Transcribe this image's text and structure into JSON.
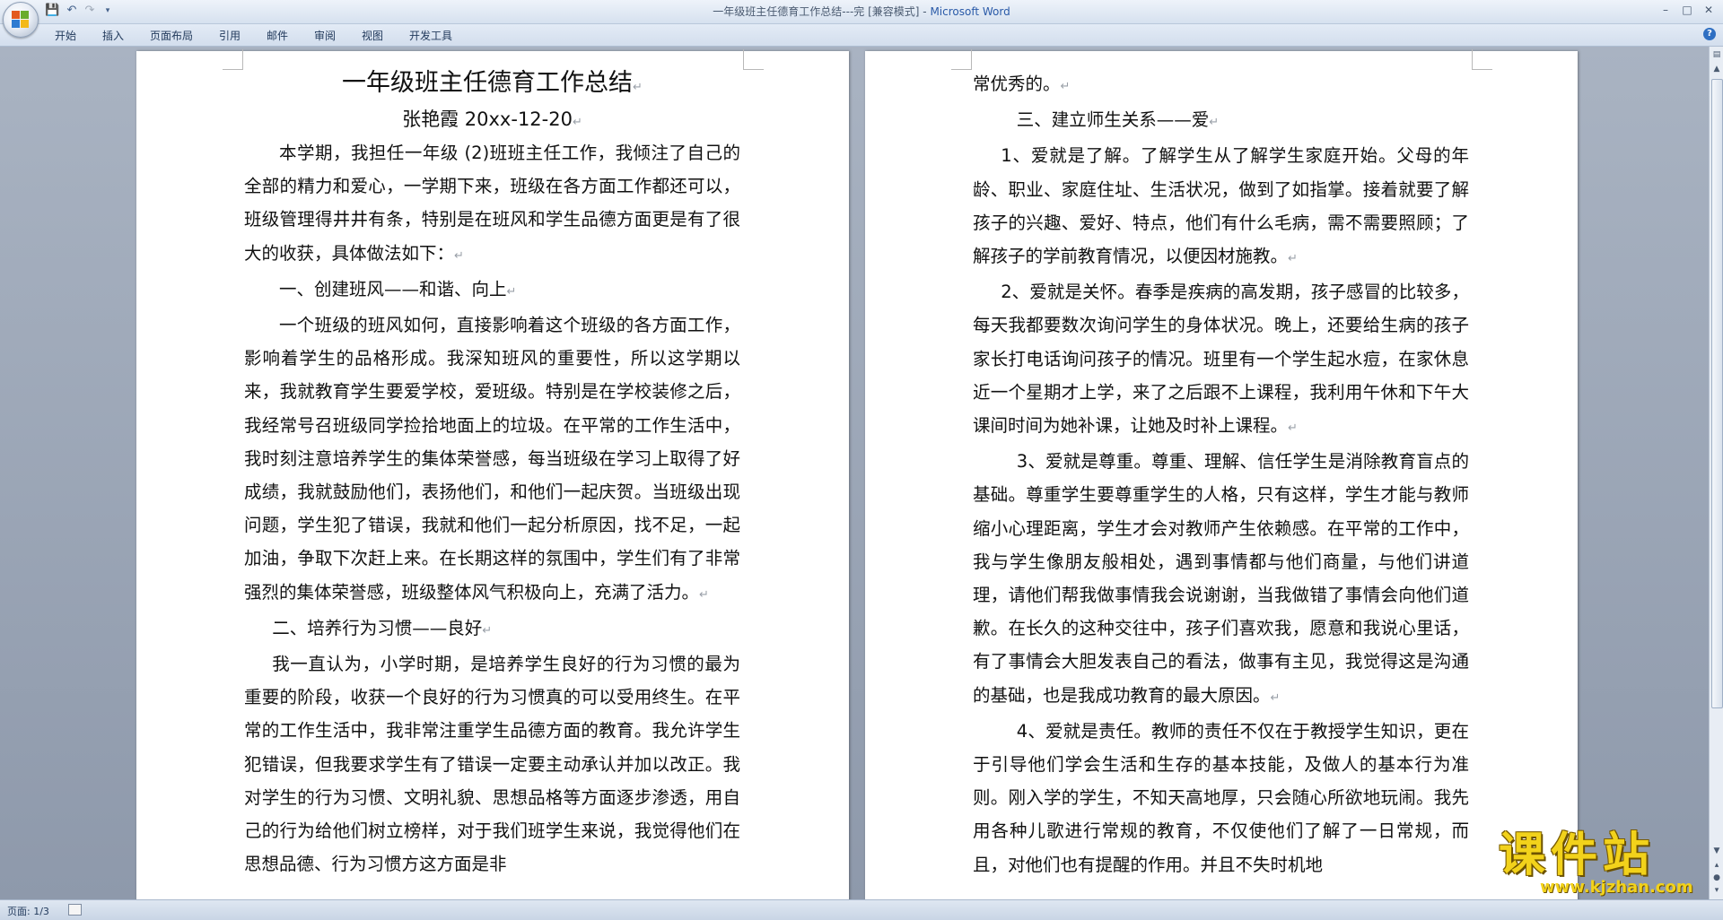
{
  "window": {
    "title": "一年级班主任德育工作总结---完 [兼容模式]",
    "app_name": "Microsoft Word",
    "controls": [
      "–",
      "□",
      "✕"
    ]
  },
  "qat": {
    "save_icon": "save-icon",
    "undo_icon": "undo-icon",
    "redo_icon": "redo-icon",
    "customize_icon": "customize-icon"
  },
  "ribbon": {
    "tabs": [
      "开始",
      "插入",
      "页面布局",
      "引用",
      "邮件",
      "审阅",
      "视图",
      "开发工具"
    ]
  },
  "page1": {
    "title": "一年级班主任德育工作总结",
    "author": "张艳霞 20xx-12-20",
    "paragraphs": [
      "本学期，我担任一年级 (2)班班主任工作，我倾注了自己的全部的精力和爱心，一学期下来，班级在各方面工作都还可以，班级管理得井井有条，特别是在班风和学生品德方面更是有了很大的收获，具体做法如下：",
      "一、创建班风——和谐、向上",
      "一个班级的班风如何，直接影响着这个班级的各方面工作，影响着学生的品格形成。我深知班风的重要性，所以这学期以来，我就教育学生要爱学校，爱班级。特别是在学校装修之后，我经常号召班级同学捡拾地面上的垃圾。在平常的工作生活中，我时刻注意培养学生的集体荣誉感，每当班级在学习上取得了好成绩，我就鼓励他们，表扬他们，和他们一起庆贺。当班级出现问题，学生犯了错误，我就和他们一起分析原因，找不足，一起加油，争取下次赶上来。在长期这样的氛围中，学生们有了非常强烈的集体荣誉感，班级整体风气积极向上，充满了活力。",
      "二、培养行为习惯——良好",
      "我一直认为，小学时期，是培养学生良好的行为习惯的最为重要的阶段，收获一个良好的行为习惯真的可以受用终生。在平常的工作生活中，我非常注重学生品德方面的教育。我允许学生犯错误，但我要求学生有了错误一定要主动承认并加以改正。我对学生的行为习惯、文明礼貌、思想品格等方面逐步渗透，用自己的行为给他们树立榜样，对于我们班学生来说，我觉得他们在思想品德、行为习惯方这方面是非"
    ]
  },
  "page2": {
    "paragraphs": [
      "常优秀的。",
      "三、建立师生关系——爱",
      "1、爱就是了解。了解学生从了解学生家庭开始。父母的年龄、职业、家庭住址、生活状况，做到了如指掌。接着就要了解孩子的兴趣、爱好、特点，他们有什么毛病，需不需要照顾；了解孩子的学前教育情况，以便因材施教。",
      "2、爱就是关怀。春季是疾病的高发期，孩子感冒的比较多，每天我都要数次询问学生的身体状况。晚上，还要给生病的孩子家长打电话询问孩子的情况。班里有一个学生起水痘，在家休息近一个星期才上学，来了之后跟不上课程，我利用午休和下午大课间时间为她补课，让她及时补上课程。",
      "3、爱就是尊重。尊重、理解、信任学生是消除教育盲点的基础。尊重学生要尊重学生的人格，只有这样，学生才能与教师缩小心理距离，学生才会对教师产生依赖感。在平常的工作中，我与学生像朋友般相处，遇到事情都与他们商量，与他们讲道理，请他们帮我做事情我会说谢谢，当我做错了事情会向他们道歉。在长久的这种交往中，孩子们喜欢我，愿意和我说心里话，有了事情会大胆发表自己的看法，做事有主见，我觉得这是沟通的基础，也是我成功教育的最大原因。",
      "4、爱就是责任。教师的责任不仅在于教授学生知识，更在于引导他们学会生活和生存的基本技能，及做人的基本行为准则。刚入学的学生，不知天高地厚，只会随心所欲地玩闹。我先用各种儿歌进行常规的教育，不仅使他们了解了一日常规，而且，对他们也有提醒的作用。并且不失时机地"
    ]
  },
  "paragraph_mark": "↵",
  "statusbar": {
    "page": "页面: 1/3"
  },
  "watermark": {
    "text": "课件站",
    "url": "www.kjzhan.com"
  },
  "colors": {
    "accent": "#2a5aa8",
    "workspace": "#9da8b8",
    "watermark": "#f2d21b"
  }
}
